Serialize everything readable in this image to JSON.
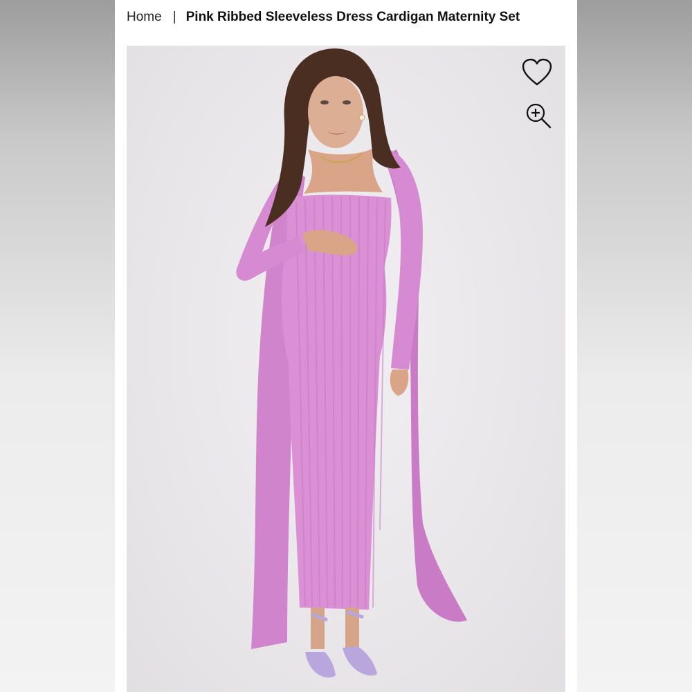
{
  "breadcrumb": {
    "home": "Home",
    "separator": "|",
    "current": "Pink Ribbed Sleeveless Dress Cardigan Maternity Set"
  },
  "product": {
    "image_alt": "Pink Ribbed Sleeveless Dress Cardigan Maternity Set",
    "colors": {
      "dress": "#d88dd4",
      "background": "#e9e6ea",
      "sandals": "#b9a6dc"
    }
  },
  "icons": {
    "wishlist": "heart-icon",
    "zoom": "zoom-in-icon"
  }
}
